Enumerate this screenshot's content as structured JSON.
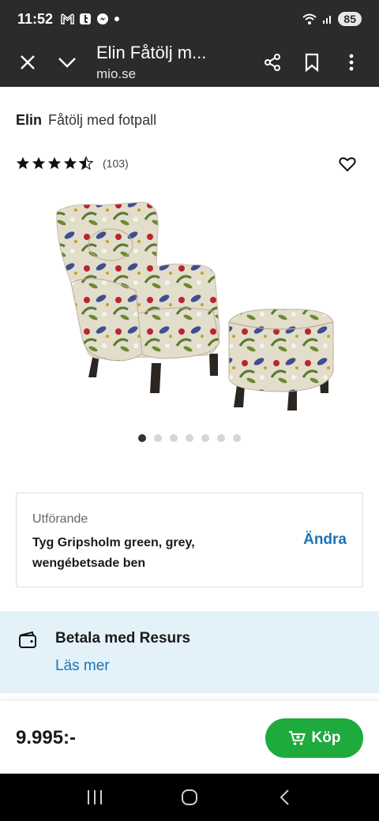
{
  "status_bar": {
    "time": "11:52",
    "battery": "85"
  },
  "toolbar": {
    "title": "Elin Fåtölj m...",
    "url": "mio.se"
  },
  "product": {
    "brand": "Elin",
    "subtitle": "Fåtölj med fotpall",
    "rating_stars": 4.5,
    "rating_count": "(103)",
    "image_count": 7,
    "image_active": 1
  },
  "variant": {
    "label": "Utförande",
    "value": "Tyg Gripsholm green, grey, wengébetsade ben",
    "change_label": "Ändra"
  },
  "payment": {
    "title": "Betala med Resurs",
    "link": "Läs mer"
  },
  "purchase": {
    "price": "9.995:-",
    "buy_label": "Köp"
  },
  "colors": {
    "toolbar_bg": "#2b2b2b",
    "link_blue": "#1a73b8",
    "buy_green": "#1eaa3c",
    "info_bg": "#e3f2f8"
  }
}
